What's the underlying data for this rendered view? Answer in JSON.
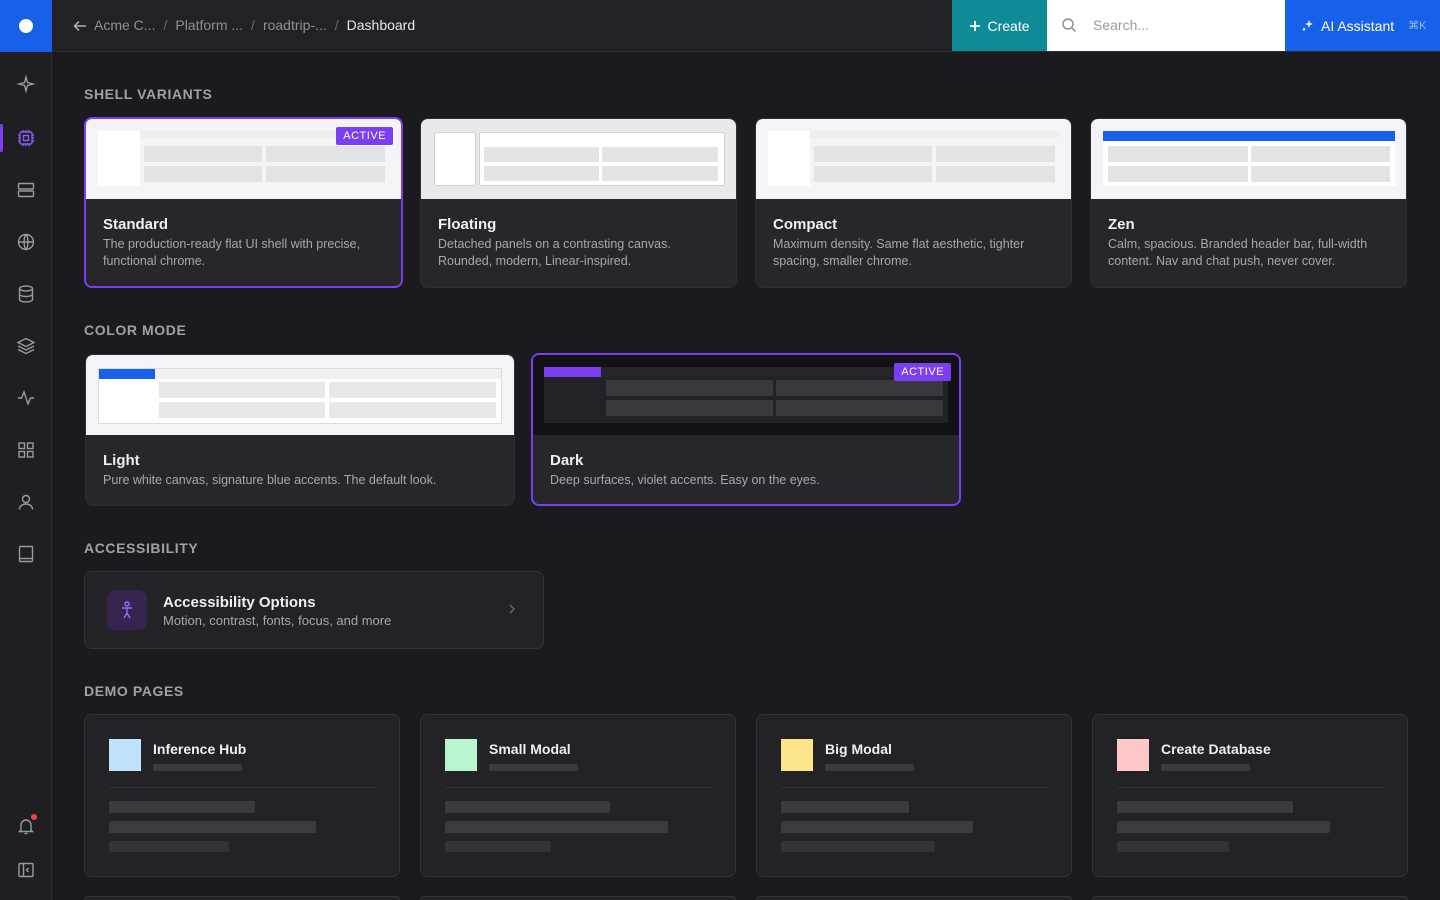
{
  "app": {
    "logo": "app-logo"
  },
  "sidebar": {
    "items": [
      {
        "name": "sparkle-icon"
      },
      {
        "name": "chip-icon",
        "active": true
      },
      {
        "name": "server-icon"
      },
      {
        "name": "globe-icon"
      },
      {
        "name": "database-icon"
      },
      {
        "name": "layers-icon"
      },
      {
        "name": "activity-icon"
      },
      {
        "name": "grid-icon"
      },
      {
        "name": "user-icon"
      },
      {
        "name": "book-icon"
      }
    ],
    "bottom": [
      {
        "name": "bell-icon",
        "has_notification": true
      },
      {
        "name": "panel-toggle-icon"
      }
    ]
  },
  "topbar": {
    "breadcrumbs": [
      "Acme C...",
      "Platform ...",
      "roadtrip-...",
      "Dashboard"
    ],
    "create_label": "Create",
    "search_placeholder": "Search...",
    "ai_label": "AI Assistant",
    "ai_shortcut": "⌘K"
  },
  "sections": {
    "shell": "SHELL VARIANTS",
    "color": "COLOR MODE",
    "accessibility": "ACCESSIBILITY",
    "demo": "DEMO PAGES"
  },
  "shell_variants": [
    {
      "title": "Standard",
      "desc": "The production-ready flat UI shell with precise, functional chrome.",
      "active": true,
      "badge": "ACTIVE"
    },
    {
      "title": "Floating",
      "desc": "Detached panels on a contrasting canvas. Rounded, modern, Linear-inspired."
    },
    {
      "title": "Compact",
      "desc": "Maximum density. Same flat aesthetic, tighter spacing, smaller chrome."
    },
    {
      "title": "Zen",
      "desc": "Calm, spacious. Branded header bar, full-width content. Nav and chat push, never cover."
    }
  ],
  "color_modes": [
    {
      "title": "Light",
      "desc": "Pure white canvas, signature blue accents. The default look."
    },
    {
      "title": "Dark",
      "desc": "Deep surfaces, violet accents. Easy on the eyes.",
      "active": true,
      "badge": "ACTIVE"
    }
  ],
  "accessibility": {
    "title": "Accessibility Options",
    "subtitle": "Motion, contrast, fonts, focus, and more"
  },
  "demo_pages": [
    {
      "title": "Inference Hub",
      "color": "#bfe3fb"
    },
    {
      "title": "Small Modal",
      "color": "#b9f5cf"
    },
    {
      "title": "Big Modal",
      "color": "#fde58a"
    },
    {
      "title": "Create Database",
      "color": "#fcc8c8"
    }
  ],
  "colors": {
    "accent_violet": "#7a3ff2",
    "brand_blue": "#1760ea",
    "teal": "#0f8b96"
  }
}
